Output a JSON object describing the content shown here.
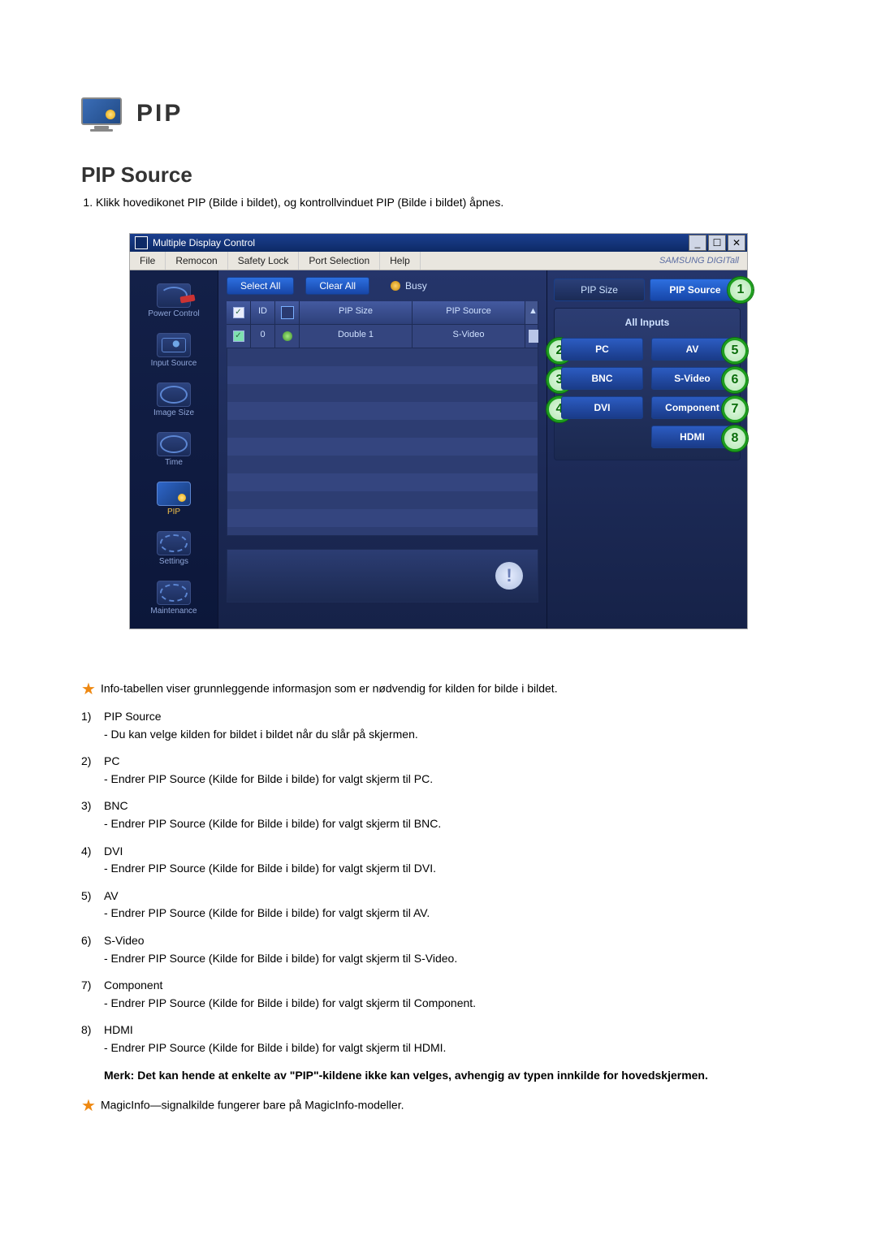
{
  "page": {
    "title": "PIP",
    "subtitle": "PIP Source",
    "intro_1": "Klikk hovedikonet PIP (Bilde i bildet), og kontrollvinduet PIP (Bilde i bildet) åpnes."
  },
  "app": {
    "titlebar": "Multiple Display Control",
    "brand": "SAMSUNG DIGITall",
    "menus": {
      "file": "File",
      "remocon": "Remocon",
      "safety": "Safety Lock",
      "port": "Port Selection",
      "help": "Help"
    },
    "sidebar": {
      "power": "Power Control",
      "input": "Input Source",
      "image": "Image Size",
      "time": "Time",
      "pip": "PIP",
      "settings": "Settings",
      "maint": "Maintenance"
    },
    "center": {
      "select_all": "Select All",
      "clear_all": "Clear All",
      "busy": "Busy",
      "headers": {
        "id": "ID",
        "pip_size": "PIP Size",
        "pip_source": "PIP Source"
      },
      "row1": {
        "id": "0",
        "pip_size": "Double 1",
        "pip_source": "S-Video"
      }
    },
    "right": {
      "tab_size": "PIP Size",
      "tab_source": "PIP Source",
      "panel_title": "All Inputs",
      "pc": "PC",
      "bnc": "BNC",
      "dvi": "DVI",
      "av": "AV",
      "svideo": "S-Video",
      "component": "Component",
      "hdmi": "HDMI"
    },
    "callouts": {
      "c1": "1",
      "c2": "2",
      "c3": "3",
      "c4": "4",
      "c5": "5",
      "c6": "6",
      "c7": "7",
      "c8": "8"
    }
  },
  "notes": {
    "star1": "Info-tabellen viser grunnleggende informasjon som er nødvendig for kilden for bilde i bildet.",
    "items": [
      {
        "n": "1)",
        "t": "PIP Source",
        "d": "- Du kan velge kilden for bildet i bildet når du slår på skjermen."
      },
      {
        "n": "2)",
        "t": "PC",
        "d": "- Endrer PIP Source (Kilde for Bilde i bilde) for valgt skjerm til PC."
      },
      {
        "n": "3)",
        "t": "BNC",
        "d": "- Endrer PIP Source (Kilde for Bilde i bilde) for valgt skjerm til BNC."
      },
      {
        "n": "4)",
        "t": "DVI",
        "d": "- Endrer PIP Source (Kilde for Bilde i bilde) for valgt skjerm til DVI."
      },
      {
        "n": "5)",
        "t": "AV",
        "d": "- Endrer PIP Source (Kilde for Bilde i bilde) for valgt skjerm til AV."
      },
      {
        "n": "6)",
        "t": "S-Video",
        "d": "- Endrer PIP Source (Kilde for Bilde i bilde) for valgt skjerm til S-Video."
      },
      {
        "n": "7)",
        "t": "Component",
        "d": "- Endrer PIP Source (Kilde for Bilde i bilde) for valgt skjerm til Component."
      },
      {
        "n": "8)",
        "t": "HDMI",
        "d": "- Endrer PIP Source (Kilde for Bilde i bilde) for valgt skjerm til HDMI."
      }
    ],
    "merk": "Merk: Det kan hende at enkelte av \"PIP\"-kildene ikke kan velges, avhengig av typen innkilde for hovedskjermen.",
    "star2": "MagicInfo—signalkilde fungerer bare på MagicInfo-modeller."
  }
}
